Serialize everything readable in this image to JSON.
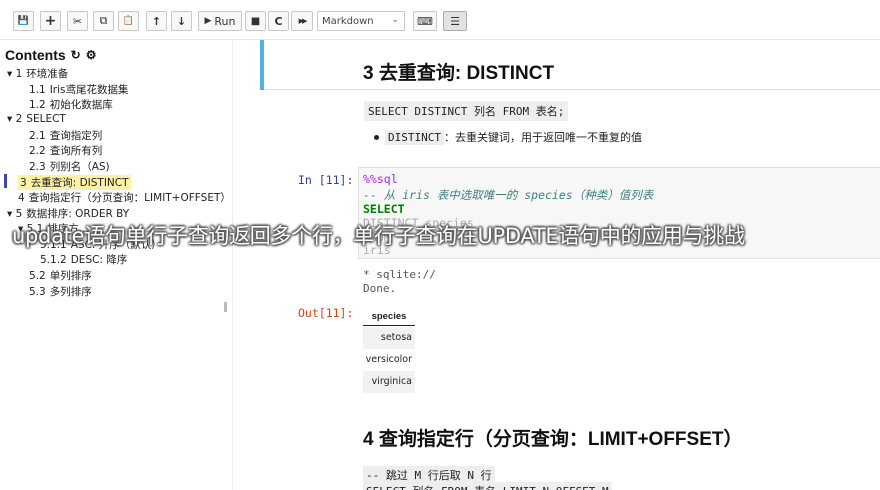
{
  "toolbar": {
    "buttons": [
      {
        "icon": "save-icon",
        "glyph": "💾",
        "label": ""
      },
      {
        "icon": "plus-icon",
        "glyph": "+",
        "label": ""
      },
      {
        "icon": "scissors-icon",
        "glyph": "✂",
        "label": ""
      },
      {
        "icon": "copy-icon",
        "glyph": "⧉",
        "label": ""
      },
      {
        "icon": "paste-icon",
        "glyph": "📋",
        "label": ""
      },
      {
        "icon": "arrow-up-icon",
        "glyph": "↑",
        "label": ""
      },
      {
        "icon": "arrow-down-icon",
        "glyph": "↓",
        "label": ""
      },
      {
        "icon": "play-icon",
        "glyph": "▶",
        "label": "Run"
      },
      {
        "icon": "stop-icon",
        "glyph": "■",
        "label": ""
      },
      {
        "icon": "restart-icon",
        "glyph": "C",
        "label": ""
      },
      {
        "icon": "fast-forward-icon",
        "glyph": "▶▶",
        "label": ""
      },
      {
        "icon": "keyboard-icon",
        "glyph": "⌨",
        "label": ""
      },
      {
        "icon": "list-icon",
        "glyph": "☰",
        "label": ""
      }
    ],
    "cell_type": "Markdown"
  },
  "toc": {
    "title": "Contents",
    "items": [
      {
        "prefix": "▾ 1",
        "label": "环境准备"
      },
      {
        "prefix": "1.1",
        "label": "Iris鸢尾花数据集"
      },
      {
        "prefix": "1.2",
        "label": "初始化数据库"
      },
      {
        "prefix": "▾ 2",
        "label": "SELECT"
      },
      {
        "prefix": "2.1",
        "label": "查询指定列"
      },
      {
        "prefix": "2.2",
        "label": "查询所有列"
      },
      {
        "prefix": "2.3",
        "label": "列别名（AS)"
      },
      {
        "prefix": "3",
        "label": "去重查询: DISTINCT"
      },
      {
        "prefix": "4",
        "label": "查询指定行（分页查询：LIMIT+OFFSET）"
      },
      {
        "prefix": "▾ 5",
        "label": "数据排序: ORDER BY"
      },
      {
        "prefix": "▾ 5.1",
        "label": "排序方..."
      },
      {
        "prefix": "5.1.1",
        "label": "ASC: 升序（默认）"
      },
      {
        "prefix": "5.1.2",
        "label": "DESC: 降序"
      },
      {
        "prefix": "5.2",
        "label": "单列排序"
      },
      {
        "prefix": "5.3",
        "label": "多列排序"
      }
    ]
  },
  "notebook": {
    "section3_title": "3  去重查询: DISTINCT",
    "syntax": "SELECT DISTINCT 列名 FROM 表名;",
    "bullet_code": "DISTINCT",
    "bullet_text": "：去重关键词，用于返回唯一不重复的值",
    "in_prompt": "In [11]:",
    "code": [
      "%%sql",
      "-- 从 iris 表中选取唯一的 species（种类）值列表",
      "SELECT",
      "    DISTINCT species",
      "FROM",
      "    iris"
    ],
    "stdout": [
      " * sqlite://",
      "Done."
    ],
    "out_prompt": "Out[11]:",
    "table": {
      "header": "species",
      "rows": [
        "setosa",
        "versicolor",
        "virginica"
      ]
    },
    "section4_title": "4  查询指定行（分页查询：LIMIT+OFFSET）",
    "code4": [
      "-- 跳过 M 行后取 N 行",
      "SELECT 列名 FROM 表名 LIMIT N OFFSET M"
    ]
  },
  "overlay_caption": "update语句单行子查询返回多个行，单行子查询在UPDATE语句中的应用与挑战"
}
